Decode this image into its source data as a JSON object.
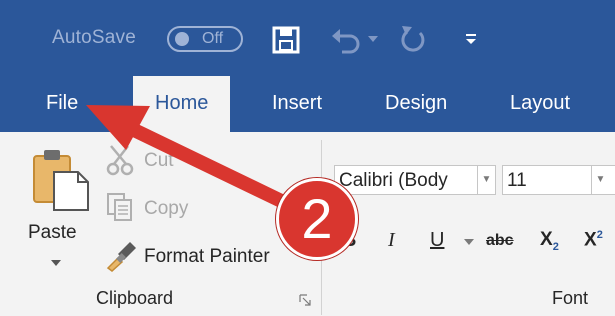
{
  "title_bar": {
    "autosave_label": "AutoSave",
    "autosave_state": "Off"
  },
  "tabs": [
    {
      "label": "File"
    },
    {
      "label": "Home"
    },
    {
      "label": "Insert"
    },
    {
      "label": "Design"
    },
    {
      "label": "Layout"
    }
  ],
  "clipboard": {
    "cut_label": "Cut",
    "copy_label": "Copy",
    "paste_label": "Paste",
    "format_painter_label": "Format Painter",
    "group_label": "Clipboard"
  },
  "font": {
    "font_name": "Calibri (Body",
    "font_size": "11",
    "bold": "B",
    "italic": "I",
    "underline": "U",
    "strikethrough": "abc",
    "subscript_base": "X",
    "subscript_mark": "2",
    "superscript_base": "X",
    "superscript_mark": "2",
    "group_label": "Font"
  },
  "annotation": {
    "step_number": "2",
    "color": "#d9362f"
  },
  "colors": {
    "ribbon_blue": "#2b579a",
    "ribbon_body": "#f3f3f3"
  }
}
